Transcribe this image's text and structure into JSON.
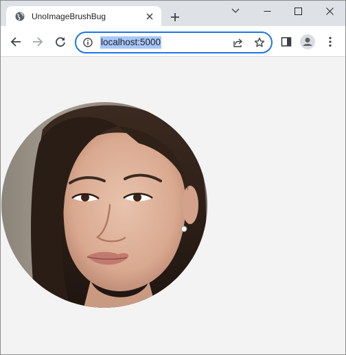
{
  "browser": {
    "tab": {
      "title": "UnoImageBrushBug",
      "favicon": "globe-icon",
      "close_icon": "close-icon"
    },
    "new_tab_icon": "plus-icon",
    "window_controls": [
      "chevron-down-icon",
      "minimize-icon",
      "maximize-icon",
      "close-icon"
    ],
    "toolbar": {
      "back_icon": "arrow-left-icon",
      "forward_icon": "arrow-right-icon",
      "reload_icon": "reload-icon",
      "address": "localhost:5000",
      "site_info_icon": "info-icon",
      "share_icon": "share-icon",
      "bookmark_icon": "star-icon",
      "side_panel_icon": "side-panel-icon",
      "profile_icon": "profile-avatar-icon",
      "menu_icon": "kebab-menu-icon"
    },
    "colors": {
      "tabstrip": "#dee1e6",
      "omnibox_border": "#1a73e8",
      "url_selection": "#a8c7fa",
      "page_background": "#f3f3f3"
    }
  },
  "page": {
    "image": {
      "shape": "circle",
      "subject": "portrait-photo"
    }
  }
}
